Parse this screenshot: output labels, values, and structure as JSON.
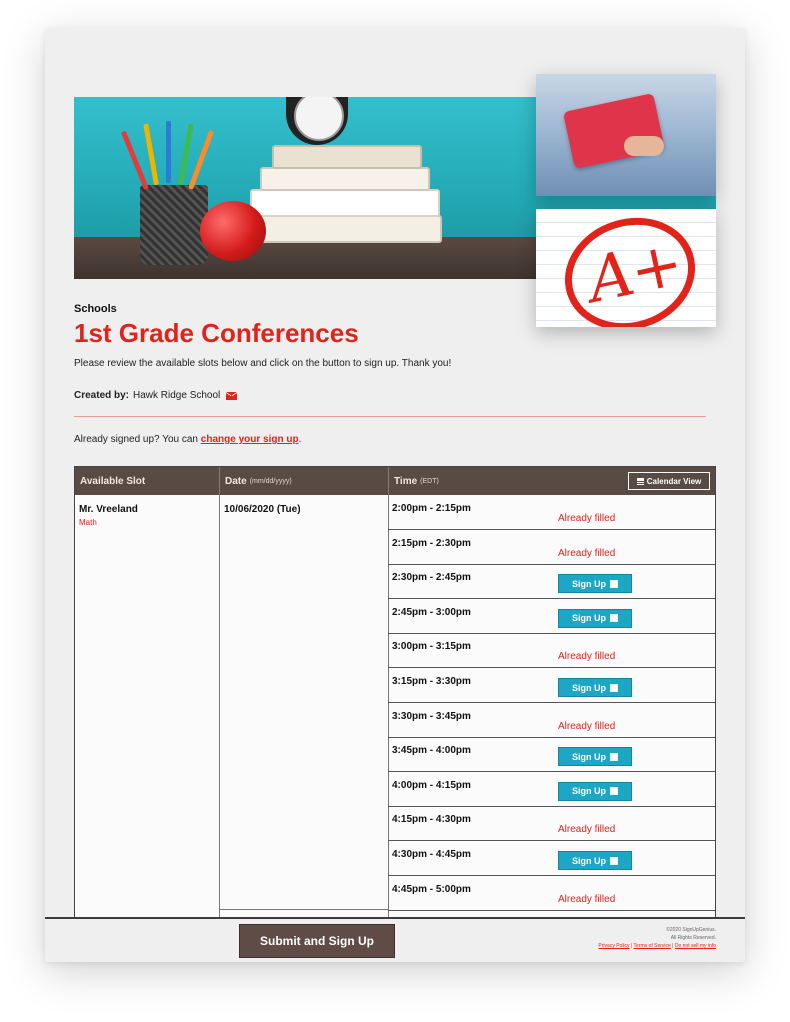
{
  "header": {
    "breadcrumb": "Schools",
    "title": "1st Grade Conferences",
    "intro": "Please review the available slots below and click on the button to sign up. Thank you!",
    "created_by_label": "Created by:",
    "created_by_value": "Hawk Ridge School",
    "already_text": "Already signed up? You can",
    "already_link": "change your sign up",
    "already_end": "."
  },
  "table": {
    "headers": {
      "slot": "Available Slot",
      "date": "Date",
      "date_sub": "(mm/dd/yyyy)",
      "time": "Time",
      "time_sub": "(EDT)",
      "calendar_view": "Calendar View"
    },
    "slot_name": "Mr. Vreeland",
    "slot_sub": "Math",
    "date": "10/06/2020 (Tue)",
    "filled_label": "Already filled",
    "signup_label": "Sign Up",
    "rows": [
      {
        "time": "2:00pm - 2:15pm",
        "status": "filled"
      },
      {
        "time": "2:15pm - 2:30pm",
        "status": "filled"
      },
      {
        "time": "2:30pm - 2:45pm",
        "status": "open"
      },
      {
        "time": "2:45pm - 3:00pm",
        "status": "open"
      },
      {
        "time": "3:00pm - 3:15pm",
        "status": "filled"
      },
      {
        "time": "3:15pm - 3:30pm",
        "status": "open"
      },
      {
        "time": "3:30pm - 3:45pm",
        "status": "filled"
      },
      {
        "time": "3:45pm - 4:00pm",
        "status": "open"
      },
      {
        "time": "4:00pm - 4:15pm",
        "status": "open"
      },
      {
        "time": "4:15pm - 4:30pm",
        "status": "filled"
      },
      {
        "time": "4:30pm - 4:45pm",
        "status": "open"
      },
      {
        "time": "4:45pm - 5:00pm",
        "status": "filled"
      }
    ]
  },
  "footer": {
    "submit": "Submit and Sign Up",
    "copyright": "©2020 SignUpGenius.",
    "rights": "All Rights Reserved.",
    "privacy": "Privacy Policy",
    "terms": "Terms of Service",
    "donotsell": "Do not sell my info"
  },
  "colors": {
    "accent": "#e2231a",
    "header_bg": "#5a4a44",
    "signup_button": "#1ea7c4"
  }
}
